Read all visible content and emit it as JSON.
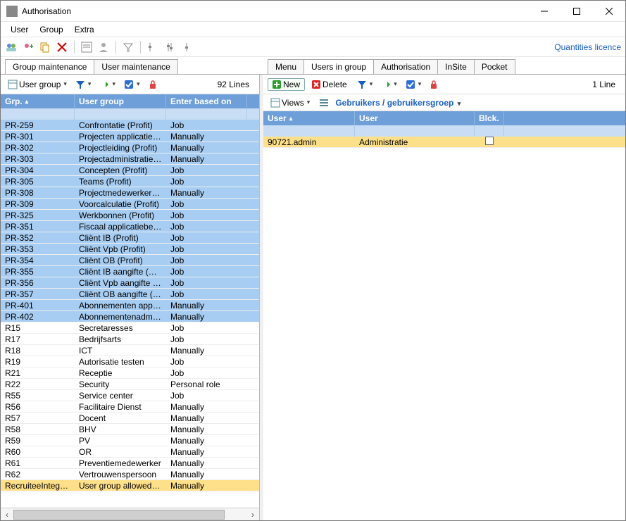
{
  "window": {
    "title": "Authorisation"
  },
  "menu": {
    "user": "User",
    "group": "Group",
    "extra": "Extra"
  },
  "toolbar_link": "Quantities licence",
  "left_tabs": {
    "maint": "Group maintenance",
    "usermaint": "User maintenance"
  },
  "right_tabs": {
    "menu": "Menu",
    "users": "Users in group",
    "auth": "Authorisation",
    "insite": "InSite",
    "pocket": "Pocket"
  },
  "left_head": {
    "dd": "User group",
    "count": "92 Lines"
  },
  "left_cols": {
    "c1": "Grp.",
    "c2": "User group",
    "c3": "Enter based on"
  },
  "left_rows": [
    {
      "c1": "PR-259",
      "c2": "Confrontatie (Profit)",
      "c3": "Job",
      "sel": true
    },
    {
      "c1": "PR-301",
      "c2": "Projecten applicatiebehe",
      "c3": "Manually",
      "sel": true
    },
    {
      "c1": "PR-302",
      "c2": "Projectleiding (Profit)",
      "c3": "Manually",
      "sel": true
    },
    {
      "c1": "PR-303",
      "c2": "Projectadministratie (Prof",
      "c3": "Manually",
      "sel": true
    },
    {
      "c1": "PR-304",
      "c2": "Concepten (Profit)",
      "c3": "Job",
      "sel": true
    },
    {
      "c1": "PR-305",
      "c2": "Teams (Profit)",
      "c3": "Job",
      "sel": true
    },
    {
      "c1": "PR-308",
      "c2": "Projectmedewerker (Prof",
      "c3": "Manually",
      "sel": true
    },
    {
      "c1": "PR-309",
      "c2": "Voorcalculatie (Profit)",
      "c3": "Job",
      "sel": true
    },
    {
      "c1": "PR-325",
      "c2": "Werkbonnen (Profit)",
      "c3": "Job",
      "sel": true
    },
    {
      "c1": "PR-351",
      "c2": "Fiscaal applicatiebeheer",
      "c3": "Job",
      "sel": true
    },
    {
      "c1": "PR-352",
      "c2": "Cliënt IB (Profit)",
      "c3": "Job",
      "sel": true
    },
    {
      "c1": "PR-353",
      "c2": "Cliënt Vpb (Profit)",
      "c3": "Job",
      "sel": true
    },
    {
      "c1": "PR-354",
      "c2": "Cliënt OB (Profit)",
      "c3": "Job",
      "sel": true
    },
    {
      "c1": "PR-355",
      "c2": "Cliënt IB aangifte (Profit)",
      "c3": "Job",
      "sel": true
    },
    {
      "c1": "PR-356",
      "c2": "Cliënt Vpb aangifte (Prof",
      "c3": "Job",
      "sel": true
    },
    {
      "c1": "PR-357",
      "c2": "Cliënt OB aangifte (Profit",
      "c3": "Job",
      "sel": true
    },
    {
      "c1": "PR-401",
      "c2": "Abonnementen applicati",
      "c3": "Manually",
      "sel": true
    },
    {
      "c1": "PR-402",
      "c2": "Abonnementenadministr",
      "c3": "Manually",
      "sel": true
    },
    {
      "c1": "R15",
      "c2": "Secretaresses",
      "c3": "Job"
    },
    {
      "c1": "R17",
      "c2": "Bedrijfsarts",
      "c3": "Job"
    },
    {
      "c1": "R18",
      "c2": "ICT",
      "c3": "Manually"
    },
    {
      "c1": "R19",
      "c2": "Autorisatie testen",
      "c3": "Job"
    },
    {
      "c1": "R21",
      "c2": "Receptie",
      "c3": "Job"
    },
    {
      "c1": "R22",
      "c2": "Security",
      "c3": "Personal role"
    },
    {
      "c1": "R55",
      "c2": "Service center",
      "c3": "Job"
    },
    {
      "c1": "R56",
      "c2": "Facilitaire Dienst",
      "c3": "Manually"
    },
    {
      "c1": "R57",
      "c2": "Docent",
      "c3": "Manually"
    },
    {
      "c1": "R58",
      "c2": "BHV",
      "c3": "Manually"
    },
    {
      "c1": "R59",
      "c2": "PV",
      "c3": "Manually"
    },
    {
      "c1": "R60",
      "c2": "OR",
      "c3": "Manually"
    },
    {
      "c1": "R61",
      "c2": "Preventiemedewerker",
      "c3": "Manually"
    },
    {
      "c1": "R62",
      "c2": "Vertrouwenspersoon",
      "c3": "Manually"
    },
    {
      "c1": "RecruiteeIntegration",
      "c2": "User group allowed to m",
      "c3": "Manually",
      "hl": true
    }
  ],
  "right_head": {
    "new": "New",
    "del": "Delete",
    "count": "1 Line"
  },
  "right_views": {
    "label": "Views",
    "path": "Gebruikers / gebruikersgroep"
  },
  "right_cols": {
    "r1": "User",
    "r2": "User",
    "r3": "Blck."
  },
  "right_rows": [
    {
      "r1": "90721.admin",
      "r2": "Administratie",
      "blck": false,
      "hl": true
    }
  ]
}
